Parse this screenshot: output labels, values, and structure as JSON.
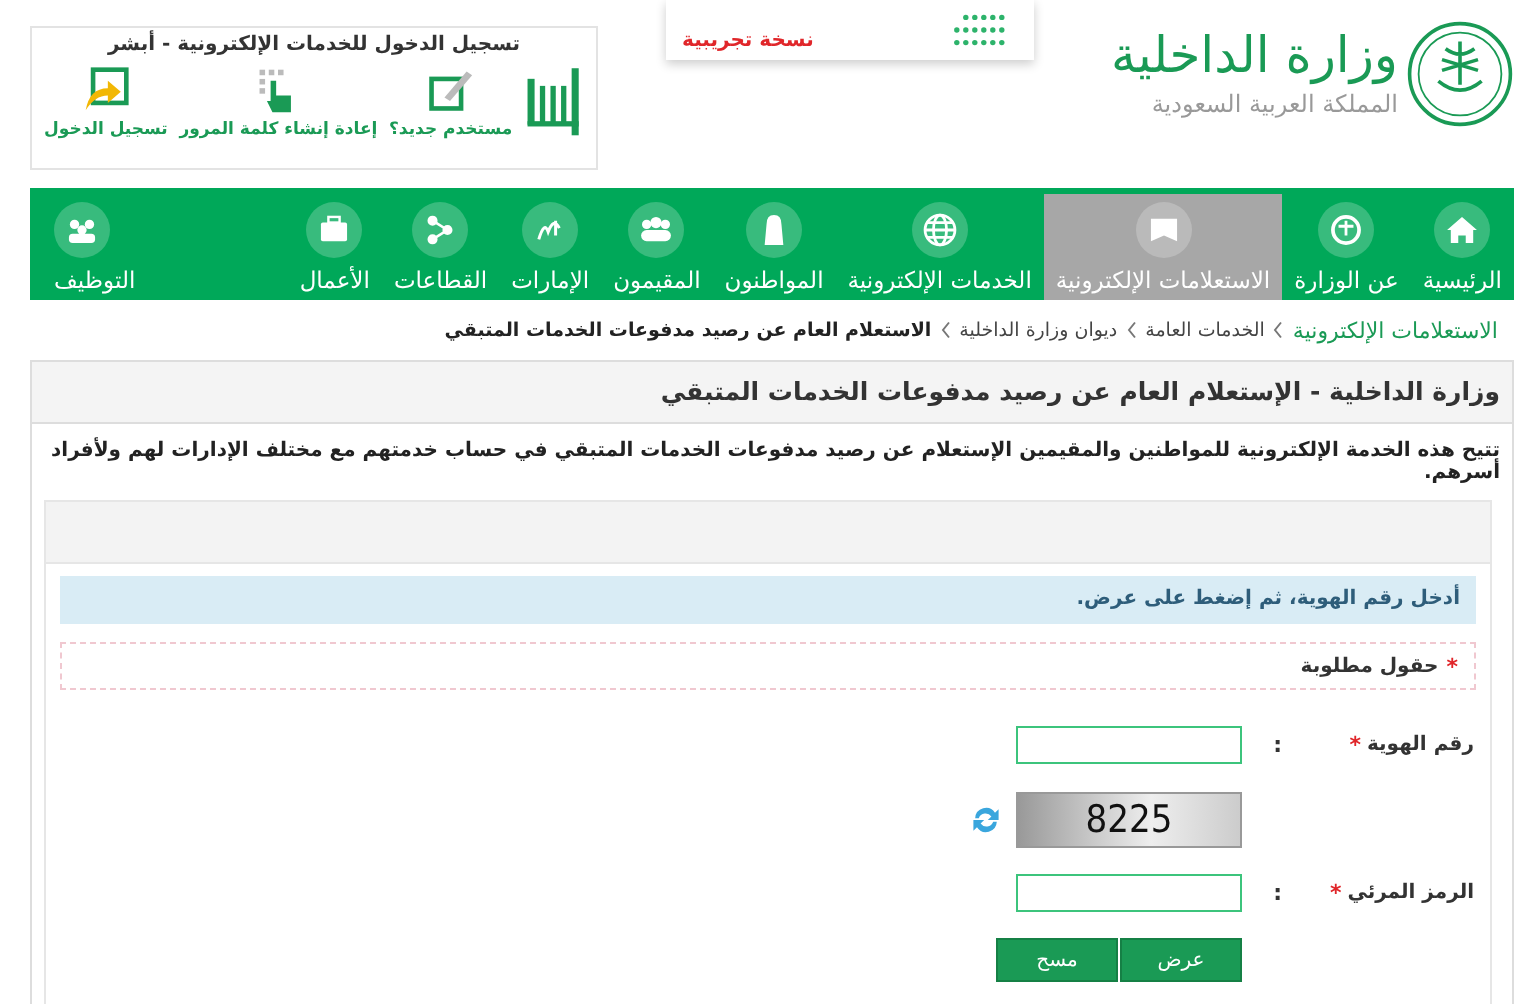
{
  "header": {
    "ministry_name": "وزارة الداخلية",
    "country_name": "المملكة العربية السعودية",
    "banner_note": "نسخة تجريبية",
    "login_box": {
      "title": "تسجيل الدخول للخدمات الإلكترونية - أبشر",
      "actions": [
        {
          "label": "مستخدم جديد؟"
        },
        {
          "label": "إعادة إنشاء كلمة المرور"
        },
        {
          "label": "تسجيل الدخول"
        }
      ]
    }
  },
  "nav": {
    "tabs": [
      {
        "label": "الرئيسية",
        "selected": false
      },
      {
        "label": "عن الوزارة",
        "selected": false
      },
      {
        "label": "الاستعلامات الإلكترونية",
        "selected": true
      },
      {
        "label": "الخدمات الإلكترونية",
        "selected": false
      },
      {
        "label": "المواطنون",
        "selected": false
      },
      {
        "label": "المقيمون",
        "selected": false
      },
      {
        "label": "الإمارات",
        "selected": false
      },
      {
        "label": "القطاعات",
        "selected": false
      },
      {
        "label": "الأعمال",
        "selected": false
      },
      {
        "label": "التوظيف",
        "selected": false
      }
    ]
  },
  "breadcrumb": [
    {
      "label": "الاستعلامات الإلكترونية",
      "kind": "link"
    },
    {
      "label": "الخدمات العامة",
      "kind": "plain"
    },
    {
      "label": "ديوان وزارة الداخلية",
      "kind": "plain"
    },
    {
      "label": "الاستعلام العام عن رصيد مدفوعات الخدمات المتبقي",
      "kind": "current"
    }
  ],
  "panel": {
    "title": "وزارة الداخلية - الإستعلام العام عن رصيد مدفوعات الخدمات المتبقي",
    "description": "تتيح هذه الخدمة الإلكترونية للمواطنين والمقيمين الإستعلام عن رصيد مدفوعات الخدمات المتبقي في حساب خدمتهم مع مختلف الإدارات لهم ولأفراد أسرهم.",
    "form": {
      "info": "أدخل رقم الهوية، ثم إضغط على عرض.",
      "required_mark": "*",
      "required_note": "حقول مطلوبة",
      "fields": [
        {
          "label": "رقم الهوية",
          "required": true,
          "separator": ":",
          "kind": "input"
        },
        {
          "kind": "captcha",
          "captcha_text": "8225"
        },
        {
          "label": "الرمز المرئي",
          "required": true,
          "separator": ":",
          "kind": "input"
        }
      ],
      "buttons": [
        {
          "label": "عرض"
        },
        {
          "label": "مسح"
        }
      ]
    }
  }
}
